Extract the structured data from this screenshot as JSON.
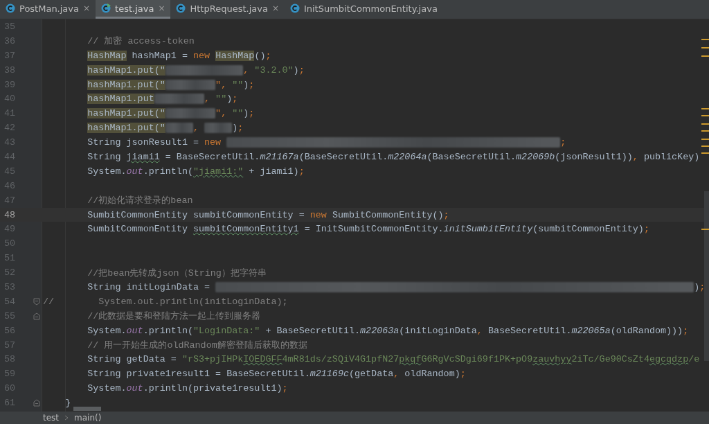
{
  "tabs": [
    {
      "label": "PostMan.java",
      "kind": "class",
      "close": "×",
      "selected": false
    },
    {
      "label": "test.java",
      "kind": "runnable",
      "close": "×",
      "selected": true
    },
    {
      "label": "HttpRequest.java",
      "kind": "class",
      "close": "×",
      "selected": false
    },
    {
      "label": "InitSumbitCommonEntity.java",
      "kind": "class",
      "selected": false
    }
  ],
  "editor": {
    "lines": [
      {
        "number": "35",
        "kind": "code",
        "selected": false
      },
      {
        "number": "36",
        "kind": "code",
        "selected": false,
        "tokens": [
          {
            "text": "// 加密 access-token",
            "kind": "comment"
          }
        ]
      },
      {
        "number": "37",
        "kind": "code",
        "selected": false,
        "tokens": [
          {
            "text": "HashMap",
            "kind": "highlight"
          },
          {
            "text": " hashMap1 = ",
            "kind": "plain"
          },
          {
            "text": "new ",
            "kind": "keyword"
          },
          {
            "text": "HashMap",
            "kind": "highlight"
          },
          {
            "text": "()",
            "kind": "plain"
          },
          {
            "text": ";",
            "kind": "keyword"
          }
        ]
      },
      {
        "number": "38",
        "kind": "code",
        "selected": false,
        "tokens": [
          {
            "text": "hashMap1.put(\"",
            "kind": "highlight"
          },
          {
            "kind": "redacted"
          },
          {
            "text": ", ",
            "kind": "keyword"
          },
          {
            "text": "\"3.2.0\"",
            "kind": "string"
          },
          {
            "text": ")",
            "kind": "plain"
          },
          {
            "text": ";",
            "kind": "keyword"
          }
        ]
      },
      {
        "number": "39",
        "kind": "code",
        "selected": false,
        "tokens": [
          {
            "text": "hashMap1.put(\"",
            "kind": "highlight"
          },
          {
            "kind": "redacted"
          },
          {
            "text": "\", ",
            "kind": "keyword"
          },
          {
            "text": "\"\"",
            "kind": "string"
          },
          {
            "text": ")",
            "kind": "plain"
          },
          {
            "text": ";",
            "kind": "keyword"
          }
        ]
      },
      {
        "number": "40",
        "kind": "code",
        "selected": false,
        "tokens": [
          {
            "text": "hashMap1.put",
            "kind": "highlight"
          },
          {
            "kind": "redacted"
          },
          {
            "text": ", ",
            "kind": "keyword"
          },
          {
            "text": "\"\"",
            "kind": "string"
          },
          {
            "text": ")",
            "kind": "plain"
          },
          {
            "text": ";",
            "kind": "keyword"
          }
        ]
      },
      {
        "number": "41",
        "kind": "code",
        "selected": false,
        "tokens": [
          {
            "text": "hashMap1.put(\"",
            "kind": "highlight"
          },
          {
            "kind": "redacted"
          },
          {
            "text": "\", ",
            "kind": "keyword"
          },
          {
            "text": "\"\"",
            "kind": "string"
          },
          {
            "text": ")",
            "kind": "plain"
          },
          {
            "text": ";",
            "kind": "keyword"
          }
        ]
      },
      {
        "number": "42",
        "kind": "code",
        "selected": false,
        "tokens": [
          {
            "text": "hashMap1.put(\"",
            "kind": "highlight"
          },
          {
            "kind": "redacted"
          },
          {
            "text": ", ",
            "kind": "keyword"
          },
          {
            "kind": "redacted"
          },
          {
            "text": ")",
            "kind": "plain"
          },
          {
            "text": ";",
            "kind": "keyword"
          }
        ]
      },
      {
        "number": "43",
        "kind": "code",
        "selected": false,
        "tokens": [
          {
            "text": "String jsonResult1 = ",
            "kind": "plain"
          },
          {
            "text": "new ",
            "kind": "keyword"
          },
          {
            "kind": "redacted"
          },
          {
            "text": ";",
            "kind": "keyword"
          }
        ]
      },
      {
        "number": "44",
        "kind": "code",
        "selected": false,
        "tokens": [
          {
            "text": "String ",
            "kind": "plain"
          },
          {
            "text": "jiami1",
            "kind": "typo"
          },
          {
            "text": " = BaseSecretUtil.",
            "kind": "plain"
          },
          {
            "text": "m21167a",
            "kind": "method"
          },
          {
            "text": "(BaseSecretUtil.",
            "kind": "plain"
          },
          {
            "text": "m22064a",
            "kind": "method"
          },
          {
            "text": "(BaseSecretUtil.",
            "kind": "plain"
          },
          {
            "text": "m22069b",
            "kind": "method"
          },
          {
            "text": "(jsonResult1))",
            "kind": "plain"
          },
          {
            "text": ", ",
            "kind": "keyword"
          },
          {
            "text": "publicKey)",
            "kind": "plain"
          }
        ]
      },
      {
        "number": "45",
        "kind": "code",
        "selected": false,
        "tokens": [
          {
            "text": "System.",
            "kind": "plain"
          },
          {
            "text": "out",
            "kind": "field"
          },
          {
            "text": ".println(",
            "kind": "plain"
          },
          {
            "text": "\"jiami1:\"",
            "kind": "string-typo"
          },
          {
            "text": " + jiami1)",
            "kind": "plain"
          },
          {
            "text": ";",
            "kind": "keyword"
          }
        ]
      },
      {
        "number": "46",
        "kind": "code",
        "selected": false
      },
      {
        "number": "47",
        "kind": "code",
        "selected": false,
        "tokens": [
          {
            "text": "//初始化请求登录的bean",
            "kind": "comment"
          }
        ]
      },
      {
        "number": "48",
        "kind": "code",
        "selected": true,
        "tokens": [
          {
            "text": "SumbitCommonEntity sumbitCommonEntity = ",
            "kind": "plain"
          },
          {
            "text": "new ",
            "kind": "keyword"
          },
          {
            "text": "SumbitCommonEntity()",
            "kind": "plain"
          },
          {
            "text": ";",
            "kind": "keyword"
          }
        ]
      },
      {
        "number": "49",
        "kind": "code",
        "selected": false,
        "tokens": [
          {
            "text": "SumbitCommonEntity ",
            "kind": "plain"
          },
          {
            "text": "sumbitCommonEntity1",
            "kind": "typo"
          },
          {
            "text": " = InitSumbitCommonEntity.",
            "kind": "plain"
          },
          {
            "text": "initSumbitEntity",
            "kind": "method"
          },
          {
            "text": "(sumbitCommonEntity)",
            "kind": "plain"
          },
          {
            "text": ";",
            "kind": "keyword"
          }
        ]
      },
      {
        "number": "50",
        "kind": "code",
        "selected": false
      },
      {
        "number": "51",
        "kind": "code",
        "selected": false
      },
      {
        "number": "52",
        "kind": "code",
        "selected": false,
        "tokens": [
          {
            "text": "//把bean先转成json（String）把字符串",
            "kind": "comment"
          }
        ]
      },
      {
        "number": "53",
        "kind": "code",
        "selected": false,
        "tokens": [
          {
            "text": "String initLoginData = ",
            "kind": "plain"
          },
          {
            "kind": "redacted"
          },
          {
            "text": ")",
            "kind": "plain"
          },
          {
            "text": ";",
            "kind": "keyword"
          }
        ]
      },
      {
        "number": "54",
        "kind": "flush-foldstart",
        "selected": false,
        "tokens": [
          {
            "text": "//",
            "kind": "comment"
          },
          {
            "text": "System.out.println(initLoginData);",
            "kind": "commented-code"
          }
        ]
      },
      {
        "number": "55",
        "kind": "code-foldend",
        "selected": false,
        "tokens": [
          {
            "text": "//此数据是要和登陆方法一起上传到服务器",
            "kind": "comment"
          }
        ]
      },
      {
        "number": "56",
        "kind": "code",
        "selected": false,
        "tokens": [
          {
            "text": "System.",
            "kind": "plain"
          },
          {
            "text": "out",
            "kind": "field"
          },
          {
            "text": ".println(",
            "kind": "plain"
          },
          {
            "text": "\"LoginData:\"",
            "kind": "string"
          },
          {
            "text": " + BaseSecretUtil.",
            "kind": "plain"
          },
          {
            "text": "m22063a",
            "kind": "method"
          },
          {
            "text": "(initLoginData",
            "kind": "plain"
          },
          {
            "text": ", ",
            "kind": "keyword"
          },
          {
            "text": "BaseSecretUtil.",
            "kind": "plain"
          },
          {
            "text": "m22065a",
            "kind": "method"
          },
          {
            "text": "(oldRandom)))",
            "kind": "plain"
          },
          {
            "text": ";",
            "kind": "keyword"
          }
        ]
      },
      {
        "number": "57",
        "kind": "code",
        "selected": false,
        "tokens": [
          {
            "text": "// 用一开始生成的oldRandom解密登陆后获取的数据",
            "kind": "comment"
          }
        ]
      },
      {
        "number": "58",
        "kind": "code",
        "selected": false,
        "tokens": [
          {
            "text": "String getData = ",
            "kind": "plain"
          },
          {
            "text": "\"rS3+pjIHPk",
            "kind": "string"
          },
          {
            "text": "IOEDGFF",
            "kind": "string-typo"
          },
          {
            "text": "4mR81ds/zSQiV4G1pfN27",
            "kind": "string"
          },
          {
            "text": "pkqf",
            "kind": "string-typo"
          },
          {
            "text": "G6RgVcSDgi69f1PK+pO9",
            "kind": "string"
          },
          {
            "text": "zauvhyy",
            "kind": "string-typo"
          },
          {
            "text": "2iTc/Ge90CsZt4",
            "kind": "string"
          },
          {
            "text": "egcqdzp",
            "kind": "string-typo"
          },
          {
            "text": "/e",
            "kind": "string"
          }
        ]
      },
      {
        "number": "59",
        "kind": "code",
        "selected": false,
        "tokens": [
          {
            "text": "String private1result1 = BaseSecretUtil.",
            "kind": "plain"
          },
          {
            "text": "m21169c",
            "kind": "method"
          },
          {
            "text": "(getData",
            "kind": "plain"
          },
          {
            "text": ", ",
            "kind": "keyword"
          },
          {
            "text": "oldRandom)",
            "kind": "plain"
          },
          {
            "text": ";",
            "kind": "keyword"
          }
        ]
      },
      {
        "number": "60",
        "kind": "code",
        "selected": false,
        "tokens": [
          {
            "text": "System.",
            "kind": "plain"
          },
          {
            "text": "out",
            "kind": "field"
          },
          {
            "text": ".println(private1result1)",
            "kind": "plain"
          },
          {
            "text": ";",
            "kind": "keyword"
          }
        ]
      },
      {
        "number": "61",
        "kind": "half-foldend",
        "selected": false,
        "tokens": [
          {
            "text": "}",
            "kind": "plain"
          }
        ]
      }
    ]
  },
  "breadcrumb": [
    "test",
    "main()"
  ]
}
